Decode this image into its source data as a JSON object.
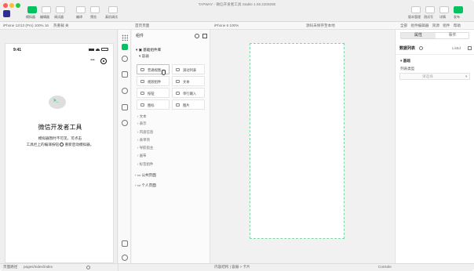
{
  "window": {
    "title": "TAPWAY - 微信开发者工具 Stable 1.06.2209290"
  },
  "toolbar": {
    "left": [
      {
        "label": "模拟器",
        "icon": "phone-icon"
      },
      {
        "label": "编辑器",
        "icon": "code-icon"
      },
      {
        "label": "调试器",
        "icon": "debug-icon"
      },
      {
        "label": "编译",
        "icon": "refresh-icon"
      },
      {
        "label": "预览",
        "icon": "eye-icon"
      },
      {
        "label": "真机调试",
        "icon": "debug-device-icon"
      }
    ],
    "right": [
      {
        "label": "版本管理",
        "icon": "version-icon"
      },
      {
        "label": "测试号",
        "icon": "test-icon"
      },
      {
        "label": "详情",
        "icon": "detail-icon"
      },
      {
        "label": "消息",
        "icon": "message-icon"
      },
      {
        "label": "发布",
        "icon": "publish-icon"
      }
    ]
  },
  "subbar": {
    "device": "iPhone 12/13 (Pro) 100% 16",
    "network": "热重载 关",
    "page": "首页页面",
    "canvas_device": "iPhone 6 100%",
    "source_tab": "源码未保存至本地",
    "right_tabs": [
      "全部",
      "组件编辑器",
      "资源",
      "组件",
      "帮助"
    ]
  },
  "phone": {
    "time": "9:41",
    "app_title": "微信开发者工具",
    "message_line1": "模拟器暂时不可见，可点击",
    "message_line2": "工具栏上的编译按钮",
    "message_line3": "重新启动模拟器。"
  },
  "files": {
    "header": "组件",
    "section_title": "基础组件库",
    "group_label": "容器",
    "cells": [
      {
        "label": "普通视图",
        "icon": "view-icon"
      },
      {
        "label": "滚动列表",
        "icon": "list-icon"
      },
      {
        "label": "视频组件",
        "icon": "video-icon"
      },
      {
        "label": "文本",
        "icon": "text-icon"
      },
      {
        "label": "按钮",
        "icon": "button-icon"
      },
      {
        "label": "单行输入",
        "icon": "input-icon"
      },
      {
        "label": "图标",
        "icon": "star-icon"
      },
      {
        "label": "图片",
        "icon": "image-icon"
      }
    ],
    "tree": [
      "文本",
      "表示",
      "内容信息",
      "表单项",
      "导航宿主",
      "画布",
      "标签组件"
    ],
    "groups": [
      "公共页面",
      "个人页面"
    ],
    "footer": "大纲树"
  },
  "canvas": {
    "device": "iPhone 6",
    "zoom": "100%"
  },
  "props": {
    "tabs": [
      "属性",
      "事件"
    ],
    "section": "数据列表",
    "section_id": "ListId",
    "group": "基础",
    "field_label": "列表类型",
    "field_value": "请选择"
  },
  "bottom": {
    "left": "页面路径",
    "path": "pages/index/index",
    "center": "内容结构 | 容器 > 卡片",
    "console": "Console"
  }
}
